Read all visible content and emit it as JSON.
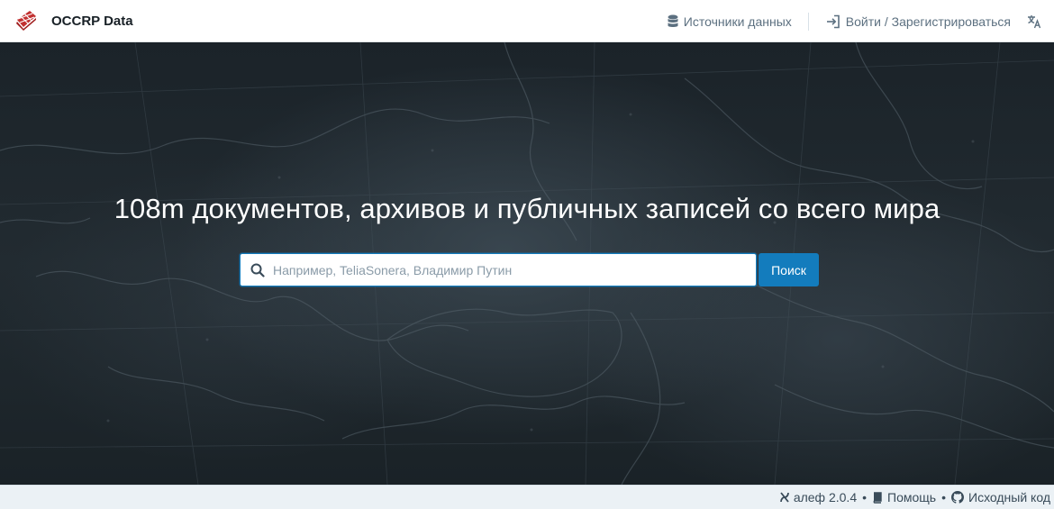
{
  "navbar": {
    "brand": "OCCRP Data",
    "sources_label": "Источники данных",
    "login_label": "Войти / Зарегистрироваться"
  },
  "hero": {
    "title": "108m документов, архивов и публичных записей со всего мира",
    "search_placeholder": "Например, TeliaSonera, Владимир Путин",
    "search_value": "",
    "search_button": "Поиск"
  },
  "footer": {
    "version": "алеф 2.0.4",
    "help": "Помощь",
    "source": "Исходный код",
    "separator": "•"
  },
  "colors": {
    "accent": "#137cbd",
    "logo_red": "#c23030",
    "hero_bg": "#1f282e",
    "footer_bg": "#ebf1f5"
  },
  "icons": [
    "database-icon",
    "log-in-icon",
    "translate-icon",
    "search-icon",
    "aleph-icon",
    "book-icon",
    "github-icon"
  ]
}
